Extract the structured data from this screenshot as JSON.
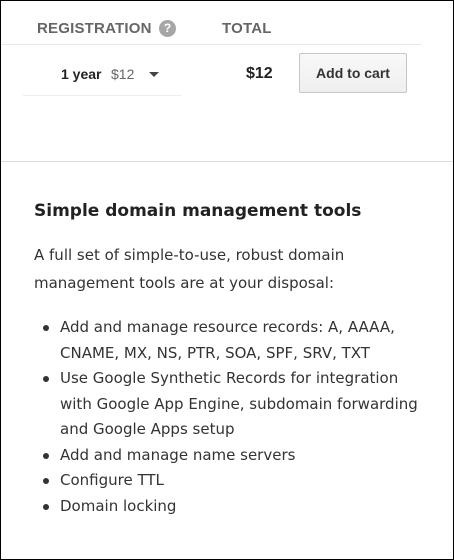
{
  "table": {
    "registration_header": "REGISTRATION",
    "help_icon": "?",
    "total_header": "TOTAL",
    "term": {
      "label": "1 year",
      "price": "$12"
    },
    "total": "$12",
    "add_to_cart_label": "Add to cart"
  },
  "section": {
    "title": "Simple domain management tools",
    "description": "A full set of simple-to-use, robust domain management tools are at your disposal:",
    "features": [
      "Add and manage resource records: A, AAAA, CNAME, MX, NS, PTR, SOA, SPF, SRV, TXT",
      "Use Google Synthetic Records for integration with Google App Engine, subdomain forwarding and Google Apps setup",
      "Add and manage name servers",
      "Configure TTL",
      "Domain locking"
    ]
  },
  "icons": {
    "help": "question-circle-icon",
    "dropdown": "caret-down-icon",
    "bullet": "bullet-icon"
  },
  "colors": {
    "header_text": "#666666",
    "body_text": "#333333",
    "button_border": "#c6c6c6"
  }
}
